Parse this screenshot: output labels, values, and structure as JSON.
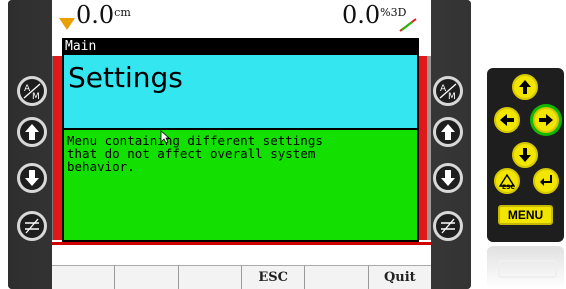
{
  "status": {
    "left_value": "0.0",
    "left_unit": "cm",
    "right_value": "0.0",
    "right_unit": "%3D"
  },
  "dialog": {
    "window_title": "Main",
    "heading": "Settings",
    "description": "Menu containing different settings\nthat do not affect overall system\nbehavior."
  },
  "function_keys": [
    "",
    "",
    "",
    "ESC",
    "",
    "Quit"
  ],
  "side_buttons": {
    "left": [
      "auto-manual-icon",
      "arrow-up-icon",
      "arrow-down-icon",
      "level-icon"
    ],
    "right": [
      "auto-manual-icon",
      "arrow-up-icon",
      "arrow-down-icon",
      "level-icon"
    ]
  },
  "keypad": {
    "buttons": [
      "arrow-up-icon",
      "arrow-left-icon",
      "arrow-right-icon",
      "arrow-down-icon",
      "escape-icon",
      "enter-icon"
    ],
    "focused": "arrow-right-icon",
    "esc_label": "ESC",
    "menu_label": "MENU"
  },
  "colors": {
    "heading_bg": "#33e6f0",
    "body_bg": "#14e000",
    "alarm_red": "#e01818",
    "key_yellow": "#f2e600",
    "focus_green": "#11b800"
  }
}
